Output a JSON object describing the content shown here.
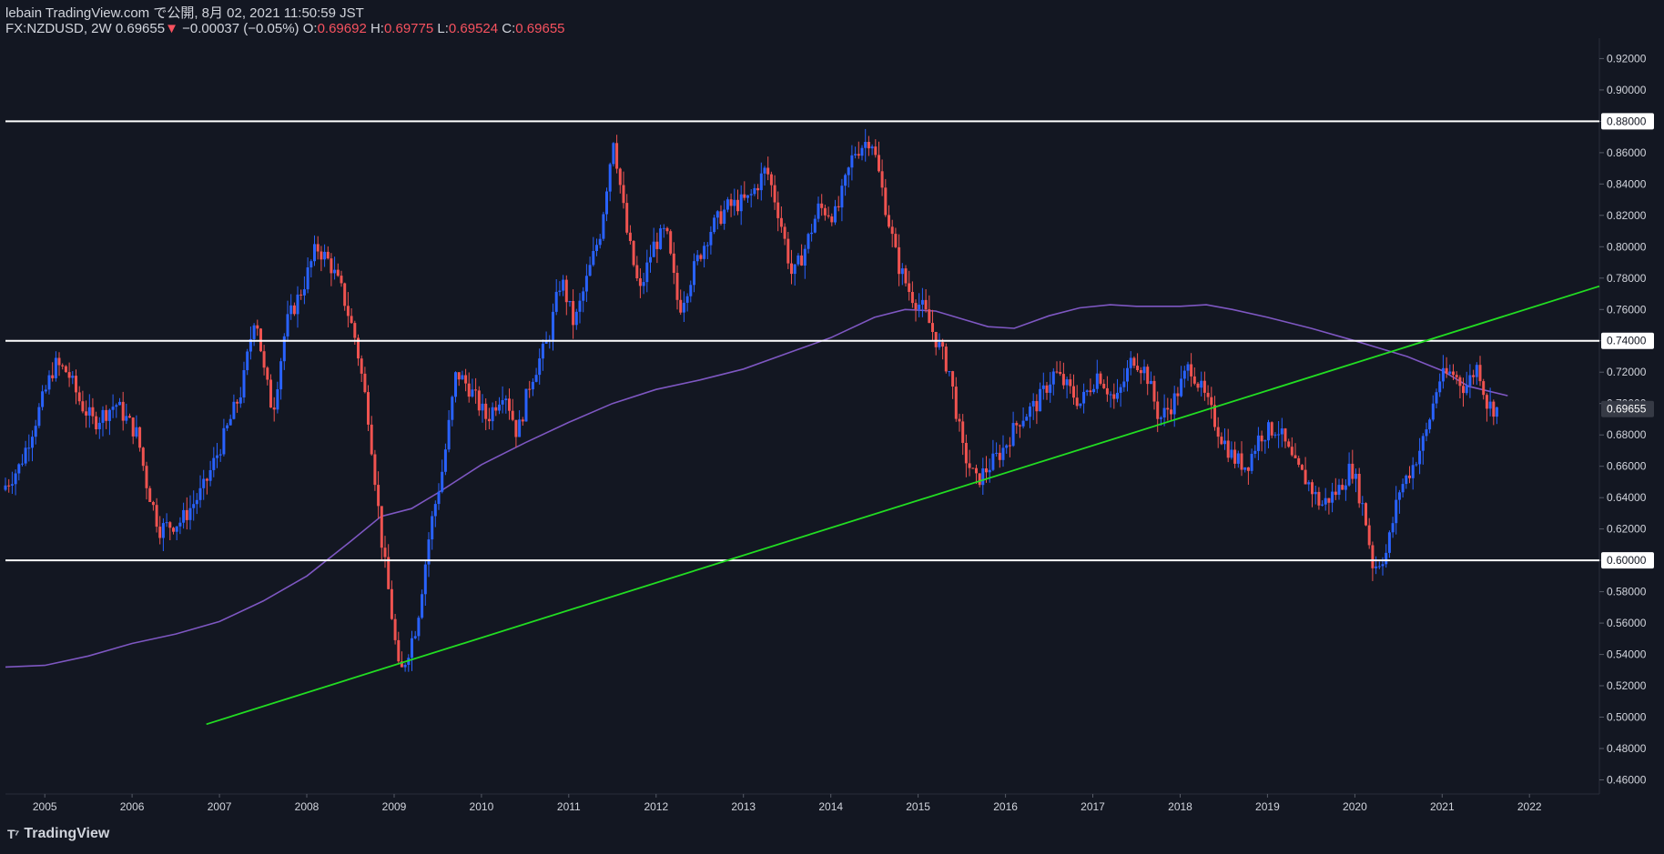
{
  "header": {
    "publisher": "lebain TradingView.com で公開, 8月 02, 2021 11:50:59 JST",
    "symbol": "FX:NZDUSD, 2W",
    "last": "0.69655",
    "change_arrow": "▼",
    "change": "−0.00037 (−0.05%)",
    "o_label": "O:",
    "o": "0.69692",
    "h_label": "H:",
    "h": "0.69775",
    "l_label": "L:",
    "l": "0.69524",
    "c_label": "C:",
    "c": "0.69655"
  },
  "footer": {
    "brand": "TradingView"
  },
  "colors": {
    "background": "#131722",
    "up": "#2962ff",
    "down": "#ef5350",
    "ma": "#7e57c2",
    "trendline": "#22dd22",
    "hline": "#ffffff",
    "axis_text": "#d1d4dc"
  },
  "chart_data": {
    "type": "candlestick",
    "title": "FX:NZDUSD, 2W",
    "xlabel": "",
    "ylabel": "",
    "x_ticks": [
      "2005",
      "2006",
      "2007",
      "2008",
      "2009",
      "2010",
      "2011",
      "2012",
      "2013",
      "2014",
      "2015",
      "2016",
      "2017",
      "2018",
      "2019",
      "2020",
      "2021",
      "2022"
    ],
    "y_ticks": [
      "0.46000",
      "0.48000",
      "0.50000",
      "0.52000",
      "0.54000",
      "0.56000",
      "0.58000",
      "0.60000",
      "0.62000",
      "0.64000",
      "0.66000",
      "0.68000",
      "0.70000",
      "0.72000",
      "0.74000",
      "0.76000",
      "0.78000",
      "0.80000",
      "0.82000",
      "0.84000",
      "0.86000",
      "0.88000",
      "0.90000",
      "0.92000"
    ],
    "x_range": [
      2004.55,
      2022.8
    ],
    "y_range": [
      0.451,
      0.933
    ],
    "grid": false,
    "last_price": "0.69655",
    "horizontal_levels": [
      "0.88000",
      "0.74000",
      "0.60000"
    ],
    "trendline": {
      "from": [
        2006.85,
        0.4955
      ],
      "to": [
        2022.8,
        0.7748
      ]
    },
    "moving_average": [
      [
        2004.55,
        0.532
      ],
      [
        2005.0,
        0.533
      ],
      [
        2005.5,
        0.539
      ],
      [
        2006.0,
        0.547
      ],
      [
        2006.5,
        0.553
      ],
      [
        2007.0,
        0.561
      ],
      [
        2007.5,
        0.574
      ],
      [
        2008.0,
        0.59
      ],
      [
        2008.5,
        0.612
      ],
      [
        2008.85,
        0.628
      ],
      [
        2009.2,
        0.633
      ],
      [
        2009.5,
        0.643
      ],
      [
        2010.0,
        0.661
      ],
      [
        2010.5,
        0.675
      ],
      [
        2011.0,
        0.688
      ],
      [
        2011.5,
        0.7
      ],
      [
        2012.0,
        0.709
      ],
      [
        2012.5,
        0.715
      ],
      [
        2013.0,
        0.722
      ],
      [
        2013.5,
        0.732
      ],
      [
        2014.0,
        0.742
      ],
      [
        2014.5,
        0.755
      ],
      [
        2014.85,
        0.76
      ],
      [
        2015.2,
        0.759
      ],
      [
        2015.5,
        0.754
      ],
      [
        2015.8,
        0.749
      ],
      [
        2016.1,
        0.748
      ],
      [
        2016.5,
        0.756
      ],
      [
        2016.85,
        0.761
      ],
      [
        2017.2,
        0.763
      ],
      [
        2017.5,
        0.762
      ],
      [
        2018.0,
        0.762
      ],
      [
        2018.3,
        0.763
      ],
      [
        2018.6,
        0.76
      ],
      [
        2019.0,
        0.755
      ],
      [
        2019.5,
        0.748
      ],
      [
        2020.0,
        0.74
      ],
      [
        2020.3,
        0.735
      ],
      [
        2020.6,
        0.73
      ],
      [
        2021.0,
        0.721
      ],
      [
        2021.3,
        0.711
      ],
      [
        2021.75,
        0.705
      ]
    ],
    "path": [
      [
        2004.55,
        0.645
      ],
      [
        2004.75,
        0.66
      ],
      [
        2005.0,
        0.7
      ],
      [
        2005.15,
        0.725
      ],
      [
        2005.3,
        0.72
      ],
      [
        2005.45,
        0.7
      ],
      [
        2005.6,
        0.688
      ],
      [
        2005.85,
        0.7
      ],
      [
        2006.1,
        0.68
      ],
      [
        2006.2,
        0.65
      ],
      [
        2006.35,
        0.62
      ],
      [
        2006.6,
        0.625
      ],
      [
        2006.85,
        0.645
      ],
      [
        2007.1,
        0.68
      ],
      [
        2007.3,
        0.71
      ],
      [
        2007.45,
        0.76
      ],
      [
        2007.55,
        0.72
      ],
      [
        2007.65,
        0.695
      ],
      [
        2007.8,
        0.75
      ],
      [
        2008.0,
        0.775
      ],
      [
        2008.15,
        0.8
      ],
      [
        2008.3,
        0.79
      ],
      [
        2008.45,
        0.77
      ],
      [
        2008.6,
        0.74
      ],
      [
        2008.75,
        0.69
      ],
      [
        2008.9,
        0.61
      ],
      [
        2009.0,
        0.57
      ],
      [
        2009.1,
        0.525
      ],
      [
        2009.3,
        0.56
      ],
      [
        2009.45,
        0.62
      ],
      [
        2009.6,
        0.66
      ],
      [
        2009.75,
        0.72
      ],
      [
        2009.9,
        0.71
      ],
      [
        2010.1,
        0.69
      ],
      [
        2010.3,
        0.71
      ],
      [
        2010.45,
        0.68
      ],
      [
        2010.6,
        0.715
      ],
      [
        2010.8,
        0.74
      ],
      [
        2010.95,
        0.78
      ],
      [
        2011.1,
        0.75
      ],
      [
        2011.25,
        0.78
      ],
      [
        2011.4,
        0.81
      ],
      [
        2011.55,
        0.87
      ],
      [
        2011.7,
        0.81
      ],
      [
        2011.85,
        0.77
      ],
      [
        2012.0,
        0.8
      ],
      [
        2012.15,
        0.81
      ],
      [
        2012.3,
        0.76
      ],
      [
        2012.5,
        0.79
      ],
      [
        2012.65,
        0.81
      ],
      [
        2012.85,
        0.825
      ],
      [
        2013.1,
        0.83
      ],
      [
        2013.3,
        0.85
      ],
      [
        2013.45,
        0.82
      ],
      [
        2013.6,
        0.78
      ],
      [
        2013.75,
        0.8
      ],
      [
        2013.9,
        0.825
      ],
      [
        2014.1,
        0.82
      ],
      [
        2014.3,
        0.86
      ],
      [
        2014.5,
        0.87
      ],
      [
        2014.65,
        0.83
      ],
      [
        2014.8,
        0.79
      ],
      [
        2014.95,
        0.77
      ],
      [
        2015.1,
        0.76
      ],
      [
        2015.25,
        0.74
      ],
      [
        2015.4,
        0.72
      ],
      [
        2015.55,
        0.67
      ],
      [
        2015.7,
        0.65
      ],
      [
        2015.85,
        0.66
      ],
      [
        2016.0,
        0.67
      ],
      [
        2016.2,
        0.69
      ],
      [
        2016.4,
        0.7
      ],
      [
        2016.6,
        0.72
      ],
      [
        2016.75,
        0.71
      ],
      [
        2016.9,
        0.7
      ],
      [
        2017.1,
        0.72
      ],
      [
        2017.3,
        0.7
      ],
      [
        2017.5,
        0.73
      ],
      [
        2017.65,
        0.72
      ],
      [
        2017.8,
        0.69
      ],
      [
        2017.95,
        0.7
      ],
      [
        2018.15,
        0.725
      ],
      [
        2018.35,
        0.7
      ],
      [
        2018.5,
        0.68
      ],
      [
        2018.65,
        0.665
      ],
      [
        2018.8,
        0.66
      ],
      [
        2018.95,
        0.68
      ],
      [
        2019.15,
        0.685
      ],
      [
        2019.35,
        0.66
      ],
      [
        2019.5,
        0.65
      ],
      [
        2019.65,
        0.635
      ],
      [
        2019.85,
        0.645
      ],
      [
        2020.0,
        0.66
      ],
      [
        2020.15,
        0.63
      ],
      [
        2020.25,
        0.595
      ],
      [
        2020.4,
        0.605
      ],
      [
        2020.55,
        0.645
      ],
      [
        2020.7,
        0.66
      ],
      [
        2020.85,
        0.68
      ],
      [
        2021.0,
        0.715
      ],
      [
        2021.15,
        0.72
      ],
      [
        2021.3,
        0.71
      ],
      [
        2021.45,
        0.725
      ],
      [
        2021.55,
        0.7
      ],
      [
        2021.65,
        0.6966
      ]
    ]
  }
}
